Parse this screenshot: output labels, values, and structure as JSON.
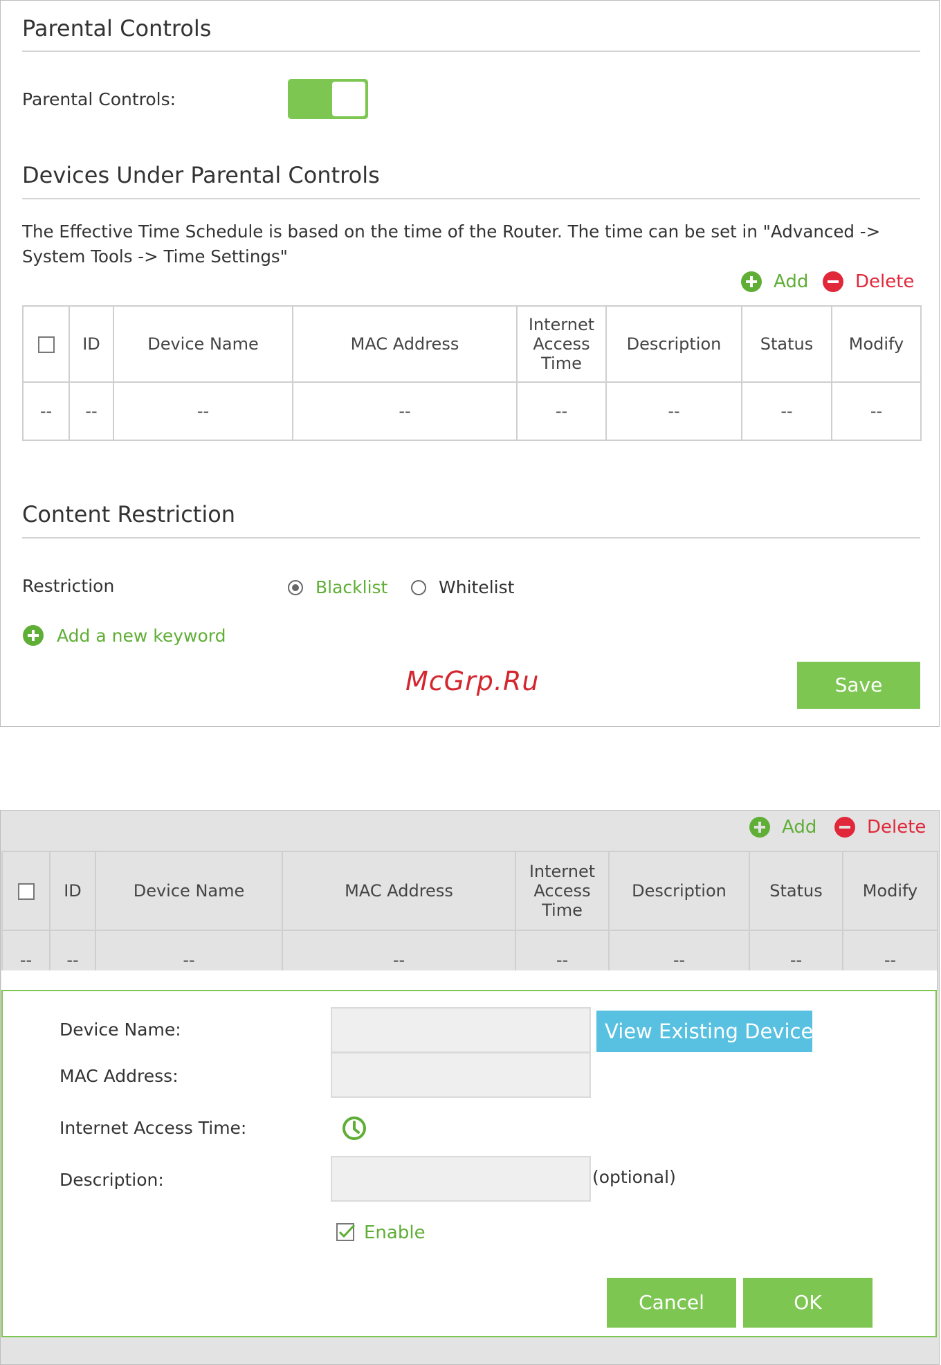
{
  "parental": {
    "title": "Parental Controls",
    "toggle_label": "Parental Controls:"
  },
  "devices": {
    "title": "Devices Under Parental Controls",
    "note_line1": "The Effective Time Schedule is based on the time of the Router. The time can be set in \"Advanced ->",
    "note_line2": "System Tools -> Time Settings\"",
    "add_label": "Add",
    "delete_label": "Delete",
    "headers": [
      "ID",
      "Device Name",
      "MAC Address",
      "Internet Access Time",
      "Description",
      "Status",
      "Modify"
    ],
    "empty_cell": "--"
  },
  "content": {
    "title": "Content Restriction",
    "restriction_label": "Restriction",
    "option_blacklist": "Blacklist",
    "option_whitelist": "Whitelist",
    "add_keyword": "Add a new keyword",
    "save_label": "Save"
  },
  "watermark": "McGrp.Ru",
  "form": {
    "device_name_label": "Device Name:",
    "view_existing_label": "View Existing Devices",
    "mac_label": "MAC Address:",
    "access_time_label": "Internet Access Time:",
    "description_label": "Description:",
    "optional_label": "(optional)",
    "enable_label": "Enable",
    "cancel_label": "Cancel",
    "ok_label": "OK"
  },
  "colors": {
    "accent_green": "#7dc652",
    "delete_red": "#e0283a",
    "button_blue": "#58c0e0"
  }
}
